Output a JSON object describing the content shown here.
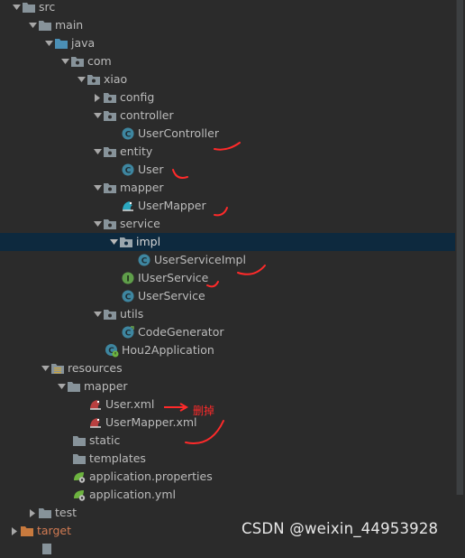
{
  "tree": [
    {
      "label": "src",
      "icon": "folder-icon",
      "arrow": "down"
    },
    {
      "label": "main",
      "icon": "folder-icon",
      "arrow": "down"
    },
    {
      "label": "java",
      "icon": "source-folder-icon",
      "arrow": "down"
    },
    {
      "label": "com",
      "icon": "package-icon",
      "arrow": "down"
    },
    {
      "label": "xiao",
      "icon": "package-icon",
      "arrow": "down"
    },
    {
      "label": "config",
      "icon": "package-icon",
      "arrow": "right"
    },
    {
      "label": "controller",
      "icon": "package-icon",
      "arrow": "down"
    },
    {
      "label": "UserController",
      "icon": "class-icon",
      "arrow": "none"
    },
    {
      "label": "entity",
      "icon": "package-icon",
      "arrow": "down"
    },
    {
      "label": "User",
      "icon": "class-icon",
      "arrow": "none"
    },
    {
      "label": "mapper",
      "icon": "package-icon",
      "arrow": "down"
    },
    {
      "label": "UserMapper",
      "icon": "mybatis-mapper-icon",
      "arrow": "none"
    },
    {
      "label": "service",
      "icon": "package-icon",
      "arrow": "down"
    },
    {
      "label": "impl",
      "icon": "package-icon",
      "arrow": "down"
    },
    {
      "label": "UserServiceImpl",
      "icon": "class-icon",
      "arrow": "none"
    },
    {
      "label": "IUserService",
      "icon": "interface-icon",
      "arrow": "none"
    },
    {
      "label": "UserService",
      "icon": "class-icon",
      "arrow": "none"
    },
    {
      "label": "utils",
      "icon": "package-icon",
      "arrow": "down"
    },
    {
      "label": "CodeGenerator",
      "icon": "class-icon",
      "arrow": "none"
    },
    {
      "label": "Hou2Application",
      "icon": "spring-boot-class-icon",
      "arrow": "none"
    },
    {
      "label": "resources",
      "icon": "resources-folder-icon",
      "arrow": "down"
    },
    {
      "label": "mapper",
      "icon": "folder-icon",
      "arrow": "down"
    },
    {
      "label": "User.xml",
      "icon": "mybatis-xml-icon",
      "arrow": "none"
    },
    {
      "label": "UserMapper.xml",
      "icon": "mybatis-xml-icon",
      "arrow": "none"
    },
    {
      "label": "static",
      "icon": "folder-icon",
      "arrow": "none"
    },
    {
      "label": "templates",
      "icon": "folder-icon",
      "arrow": "none"
    },
    {
      "label": "application.properties",
      "icon": "spring-properties-icon",
      "arrow": "none"
    },
    {
      "label": "application.yml",
      "icon": "spring-yml-icon",
      "arrow": "none"
    },
    {
      "label": "test",
      "icon": "folder-icon",
      "arrow": "right"
    },
    {
      "label": "target",
      "icon": "excluded-folder-icon",
      "arrow": "right"
    }
  ],
  "selected_row": "impl",
  "annotation": {
    "text": "删掉"
  },
  "watermark": "CSDN @weixin_44953928",
  "colors": {
    "background": "#2b2b2b",
    "selection": "#0d293e",
    "text": "#bbbbbb",
    "target_text": "#d27b53",
    "annotation": "#ff2a2a"
  }
}
